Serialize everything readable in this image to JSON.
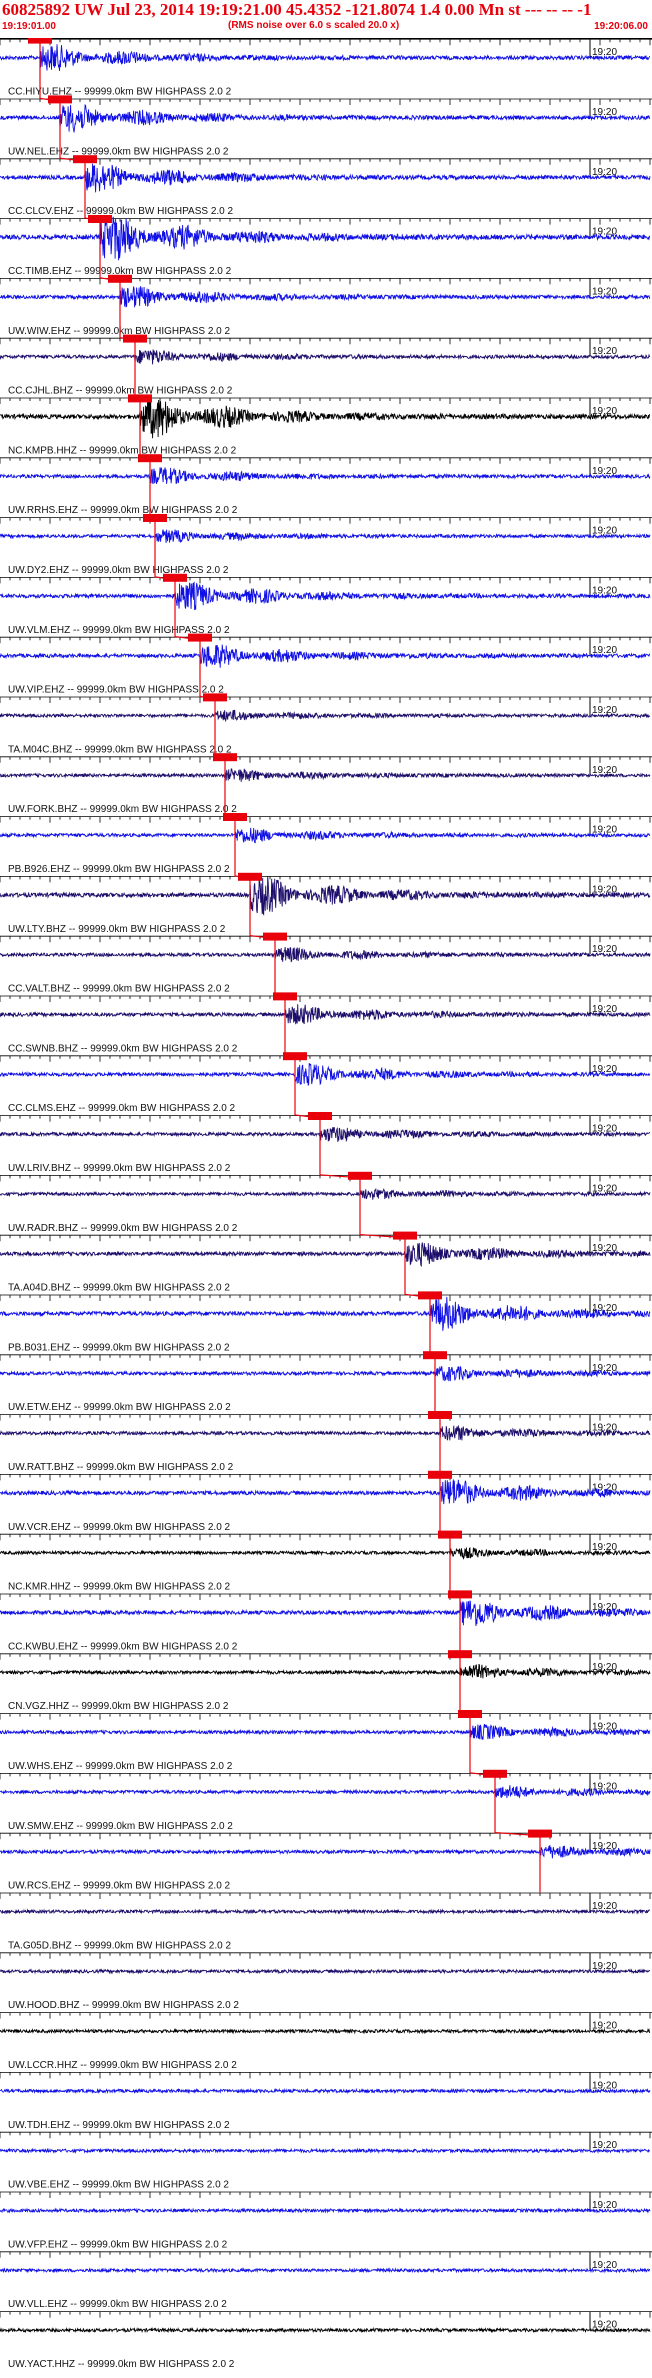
{
  "header": {
    "title": "60825892 UW Jul 23, 2014 19:19:21.00   45.4352 -121.8074  1.4 0.00 Mn st --- -- --  -1",
    "subtitle": "(RMS noise over 6.0 s scaled 20.0 x)",
    "time_start": "19:19:01.00",
    "time_end": "19:20:06.00"
  },
  "colors": {
    "red": "#e8000b",
    "blue": "#1010e6",
    "navy": "#1d0d6b",
    "black": "#000000",
    "grid": "#000000"
  },
  "chart_data": {
    "type": "line",
    "title": "60825892 UW Jul 23, 2014 19:19:21.00   45.4352 -121.8074  1.4 0.00 Mn st --- -- --  -1",
    "x_start": "19:19:01.00",
    "x_end": "19:20:06.00",
    "x_tick_label": "19:20",
    "xlim_seconds": [
      0,
      65
    ],
    "minute_mark_seconds": 59,
    "traces": [
      {
        "label": "CC.HIYU.EHZ -- 99999.0km BW  HIGHPASS  2.0  2",
        "pick": 4.0,
        "amp": 0.55,
        "color": "blue"
      },
      {
        "label": "UW.NEL.EHZ -- 99999.0km BW  HIGHPASS  2.0  2",
        "pick": 6.0,
        "amp": 0.6,
        "color": "blue"
      },
      {
        "label": "CC.CLCV.EHZ -- 99999.0km BW  HIGHPASS  2.0  2",
        "pick": 8.5,
        "amp": 0.65,
        "color": "blue"
      },
      {
        "label": "CC.TIMB.EHZ -- 99999.0km BW  HIGHPASS  2.0  2",
        "pick": 10.0,
        "amp": 1.0,
        "color": "blue"
      },
      {
        "label": "UW.WIW.EHZ -- 99999.0km BW  HIGHPASS  2.0  2",
        "pick": 12.0,
        "amp": 0.45,
        "color": "blue"
      },
      {
        "label": "CC.CJHL.BHZ -- 99999.0km BW  HIGHPASS  2.0  2",
        "pick": 13.5,
        "amp": 0.3,
        "color": "navy"
      },
      {
        "label": "NC.KMPB.HHZ -- 99999.0km BW  HIGHPASS  2.0  2",
        "pick": 14.0,
        "amp": 0.9,
        "color": "black"
      },
      {
        "label": "UW.RRHS.EHZ -- 99999.0km BW  HIGHPASS  2.0  2",
        "pick": 15.0,
        "amp": 0.35,
        "color": "blue"
      },
      {
        "label": "UW.DY2.EHZ -- 99999.0km BW  HIGHPASS  2.0  2",
        "pick": 15.5,
        "amp": 0.25,
        "color": "blue"
      },
      {
        "label": "UW.VLM.EHZ -- 99999.0km BW  HIGHPASS  2.0  2",
        "pick": 17.5,
        "amp": 0.6,
        "color": "blue"
      },
      {
        "label": "UW.VIP.EHZ -- 99999.0km BW  HIGHPASS  2.0  2",
        "pick": 20.0,
        "amp": 0.5,
        "color": "blue"
      },
      {
        "label": "TA.M04C.BHZ -- 99999.0km BW  HIGHPASS  2.0  2",
        "pick": 21.5,
        "amp": 0.2,
        "color": "navy"
      },
      {
        "label": "UW.FORK.BHZ -- 99999.0km BW  HIGHPASS  2.0  2",
        "pick": 22.5,
        "amp": 0.25,
        "color": "navy"
      },
      {
        "label": "PB.B926.EHZ -- 99999.0km BW  HIGHPASS  2.0  2",
        "pick": 23.5,
        "amp": 0.3,
        "color": "blue"
      },
      {
        "label": "UW.LTY.BHZ -- 99999.0km BW  HIGHPASS  2.0  2",
        "pick": 25.0,
        "amp": 0.8,
        "color": "navy"
      },
      {
        "label": "CC.VALT.BHZ -- 99999.0km BW  HIGHPASS  2.0  2",
        "pick": 27.5,
        "amp": 0.3,
        "color": "navy"
      },
      {
        "label": "CC.SWNB.BHZ -- 99999.0km BW  HIGHPASS  2.0  2",
        "pick": 28.5,
        "amp": 0.4,
        "color": "navy"
      },
      {
        "label": "CC.CLMS.EHZ -- 99999.0km BW  HIGHPASS  2.0  2",
        "pick": 29.5,
        "amp": 0.45,
        "color": "blue"
      },
      {
        "label": "UW.LRIV.BHZ -- 99999.0km BW  HIGHPASS  2.0  2",
        "pick": 32.0,
        "amp": 0.3,
        "color": "navy"
      },
      {
        "label": "UW.RADR.BHZ -- 99999.0km BW  HIGHPASS  2.0  2",
        "pick": 36.0,
        "amp": 0.2,
        "color": "navy"
      },
      {
        "label": "TA.A04D.BHZ -- 99999.0km BW  HIGHPASS  2.0  2",
        "pick": 40.5,
        "amp": 0.5,
        "color": "navy"
      },
      {
        "label": "PB.B031.EHZ -- 99999.0km BW  HIGHPASS  2.0  2",
        "pick": 43.0,
        "amp": 0.7,
        "color": "blue"
      },
      {
        "label": "UW.ETW.EHZ -- 99999.0km BW  HIGHPASS  2.0  2",
        "pick": 43.5,
        "amp": 0.3,
        "color": "blue"
      },
      {
        "label": "UW.RATT.BHZ -- 99999.0km BW  HIGHPASS  2.0  2",
        "pick": 44.0,
        "amp": 0.3,
        "color": "navy"
      },
      {
        "label": "UW.VCR.EHZ -- 99999.0km BW  HIGHPASS  2.0  2",
        "pick": 44.0,
        "amp": 0.6,
        "color": "blue"
      },
      {
        "label": "NC.KMR.HHZ -- 99999.0km BW  HIGHPASS  2.0  2",
        "pick": 45.0,
        "amp": 0.2,
        "color": "black"
      },
      {
        "label": "CC.KWBU.EHZ -- 99999.0km BW  HIGHPASS  2.0  2",
        "pick": 46.0,
        "amp": 0.6,
        "color": "blue"
      },
      {
        "label": "CN.VGZ.HHZ -- 99999.0km BW  HIGHPASS  2.0  2",
        "pick": 46.0,
        "amp": 0.3,
        "color": "black"
      },
      {
        "label": "UW.WHS.EHZ -- 99999.0km BW  HIGHPASS  2.0  2",
        "pick": 47.0,
        "amp": 0.3,
        "color": "blue"
      },
      {
        "label": "UW.SMW.EHZ -- 99999.0km BW  HIGHPASS  2.0  2",
        "pick": 49.5,
        "amp": 0.25,
        "color": "blue"
      },
      {
        "label": "UW.RCS.EHZ -- 99999.0km BW  HIGHPASS  2.0  2",
        "pick": 54.0,
        "amp": 0.25,
        "color": "blue"
      },
      {
        "label": "TA.G05D.BHZ -- 99999.0km BW  HIGHPASS  2.0  2",
        "pick": null,
        "amp": 0.18,
        "color": "navy"
      },
      {
        "label": "UW.HOOD.BHZ -- 99999.0km BW  HIGHPASS  2.0  2",
        "pick": null,
        "amp": 0.18,
        "color": "navy"
      },
      {
        "label": "UW.LCCR.HHZ -- 99999.0km BW  HIGHPASS  2.0  2",
        "pick": null,
        "amp": 0.2,
        "color": "black"
      },
      {
        "label": "UW.TDH.EHZ -- 99999.0km BW  HIGHPASS  2.0  2",
        "pick": null,
        "amp": 0.22,
        "color": "blue"
      },
      {
        "label": "UW.VBE.EHZ -- 99999.0km BW  HIGHPASS  2.0  2",
        "pick": null,
        "amp": 0.22,
        "color": "blue"
      },
      {
        "label": "UW.VFP.EHZ -- 99999.0km BW  HIGHPASS  2.0  2",
        "pick": null,
        "amp": 0.22,
        "color": "blue"
      },
      {
        "label": "UW.VLL.EHZ -- 99999.0km BW  HIGHPASS  2.0  2",
        "pick": null,
        "amp": 0.22,
        "color": "blue"
      },
      {
        "label": "UW.YACT.HHZ -- 99999.0km BW  HIGHPASS  2.0  2",
        "pick": null,
        "amp": 0.2,
        "color": "black"
      }
    ]
  }
}
